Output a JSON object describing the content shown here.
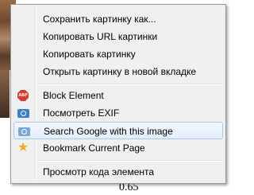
{
  "context_menu": {
    "items": [
      {
        "label": "Сохранить картинку как..."
      },
      {
        "label": "Копировать URL картинки"
      },
      {
        "label": "Копировать картинку"
      },
      {
        "label": "Открыть картинку в новой вкладке"
      },
      {
        "label": "Block Element",
        "icon": "adblock-plus-icon",
        "icon_text": "ABP"
      },
      {
        "label": "Посмотреть EXIF",
        "icon": "camera-icon"
      },
      {
        "label": "Search Google with this image",
        "icon": "camera-search-icon"
      },
      {
        "label": "Bookmark Current Page",
        "icon": "star-icon"
      },
      {
        "label": "Просмотр кода элемента"
      }
    ]
  },
  "page": {
    "bottom_value": "0.65"
  },
  "colors": {
    "menu_background": "#f0f0f0",
    "hover_border": "#a8c8ee",
    "abp_red": "#d63b2f",
    "camera_blue": "#3a7fd0",
    "star_gold": "#f0b020"
  }
}
